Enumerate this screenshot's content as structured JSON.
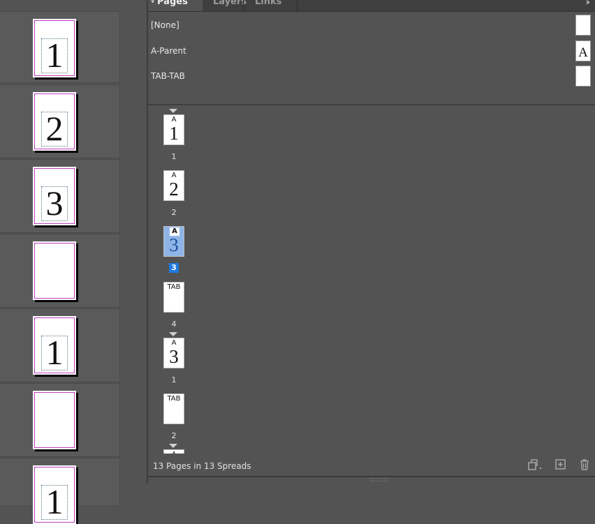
{
  "panel": {
    "tabs": [
      {
        "label": "Pages",
        "active": true
      },
      {
        "label": "Layers",
        "active": false
      },
      {
        "label": "Links",
        "active": false
      }
    ],
    "menu_glyph": "››"
  },
  "parents": [
    {
      "name": "[None]",
      "thumb": ""
    },
    {
      "name": "A-Parent",
      "thumb": "A"
    },
    {
      "name": "TAB-TAB",
      "thumb": ""
    }
  ],
  "pages": [
    {
      "prefix": "A",
      "num": "1",
      "label": "1",
      "selected": false
    },
    {
      "prefix": "A",
      "num": "2",
      "label": "2",
      "selected": false
    },
    {
      "prefix": "A",
      "num": "3",
      "label": "3",
      "selected": true
    },
    {
      "prefix": "TAB",
      "num": "",
      "label": "4",
      "selected": false
    },
    {
      "prefix": "A",
      "num": "3",
      "label": "1",
      "selected": false
    },
    {
      "prefix": "TAB",
      "num": "",
      "label": "2",
      "selected": false
    },
    {
      "prefix": "A",
      "num": "",
      "label": "",
      "selected": false
    }
  ],
  "canvas_pages": [
    {
      "num": "1"
    },
    {
      "num": "2"
    },
    {
      "num": "3"
    },
    {
      "num": ""
    },
    {
      "num": "1"
    },
    {
      "num": ""
    },
    {
      "num": "1"
    }
  ],
  "footer": {
    "status": "13 Pages in 13 Spreads",
    "icons": [
      "edit-page-size-icon",
      "new-page-icon",
      "delete-page-icon"
    ]
  },
  "colors": {
    "selection": "#1f7ae0",
    "margin_guide": "#c03cc0",
    "panel_bg": "#535353"
  }
}
